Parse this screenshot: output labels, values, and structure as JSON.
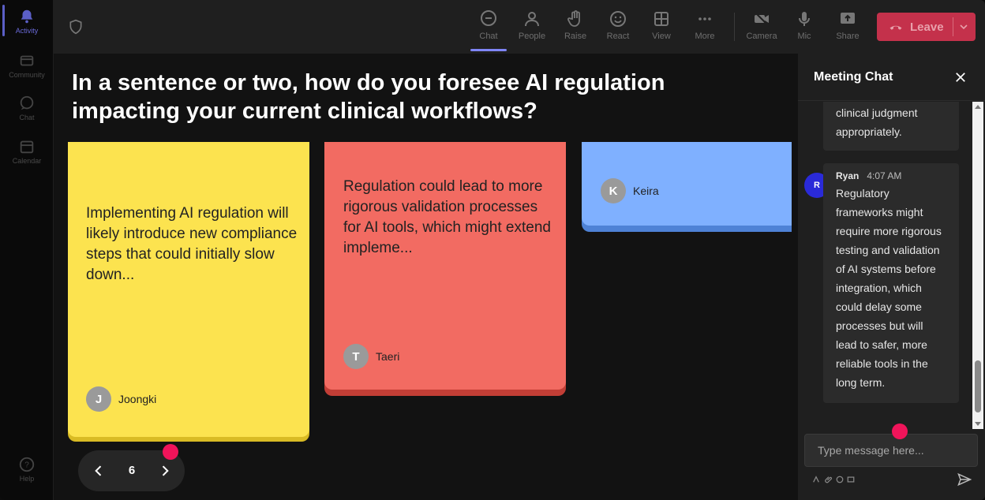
{
  "rail": {
    "items": [
      {
        "label": "Activity",
        "icon": "bell-icon"
      },
      {
        "label": "Community",
        "icon": "community-icon"
      },
      {
        "label": "Chat",
        "icon": "chat-icon"
      },
      {
        "label": "Calendar",
        "icon": "calendar-icon"
      },
      {
        "label": "Help",
        "icon": "help-icon"
      }
    ]
  },
  "toolbar": {
    "buttons": [
      {
        "label": "Chat",
        "icon": "chat-icon"
      },
      {
        "label": "People",
        "icon": "people-icon"
      },
      {
        "label": "Raise",
        "icon": "hand-icon"
      },
      {
        "label": "React",
        "icon": "smiley-icon"
      },
      {
        "label": "View",
        "icon": "grid-icon"
      },
      {
        "label": "More",
        "icon": "more-icon"
      },
      {
        "label": "Camera",
        "icon": "camera-off-icon"
      },
      {
        "label": "Mic",
        "icon": "mic-icon"
      },
      {
        "label": "Share",
        "icon": "share-icon"
      }
    ],
    "leave_label": "Leave"
  },
  "stage": {
    "question": "In a sentence or two, how do you foresee AI regulation impacting your current clinical workflows?",
    "cards": [
      {
        "text": "Implementing AI regulation will likely introduce new compliance steps that could initially slow down...",
        "author": "Joongki",
        "initial": "J",
        "color": "#fce34f"
      },
      {
        "text": "Regulation could lead to more rigorous validation processes for AI tools, which might extend impleme...",
        "author": "Taeri",
        "initial": "T",
        "color": "#f26b62"
      },
      {
        "text": "",
        "author": "Keira",
        "initial": "K",
        "color": "#7fb0ff"
      }
    ],
    "pager": {
      "current": "6"
    }
  },
  "chat": {
    "title": "Meeting Chat",
    "messages": [
      {
        "text": "clinical judgment appropriately."
      },
      {
        "author": "Ryan",
        "initial": "R",
        "time": "4:07 AM",
        "text": "Regulatory frameworks might require more rigorous testing and validation of AI systems before integration, which could delay some processes but will lead to safer, more reliable tools in the long term."
      }
    ],
    "input_placeholder": "Type message here..."
  },
  "colors": {
    "accent": "#5b5fc7",
    "leave": "#c4314b",
    "highlight_dot": "#f0145a"
  }
}
